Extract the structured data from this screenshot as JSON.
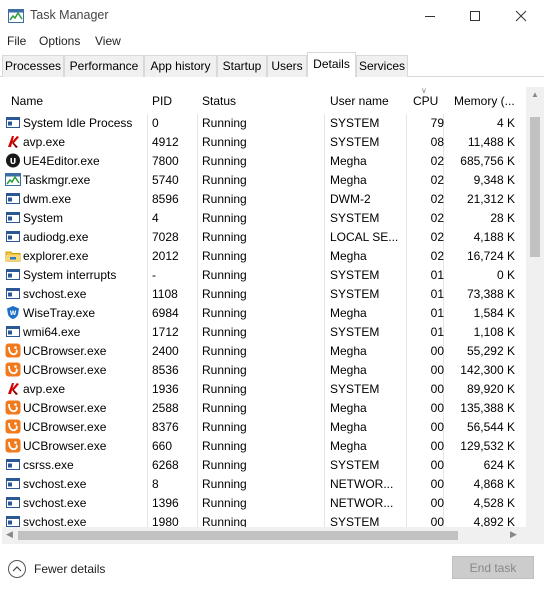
{
  "window": {
    "title": "Task Manager"
  },
  "menu": [
    "File",
    "Options",
    "View"
  ],
  "tabs": [
    {
      "label": "Processes",
      "active": false
    },
    {
      "label": "Performance",
      "active": false
    },
    {
      "label": "App history",
      "active": false
    },
    {
      "label": "Startup",
      "active": false
    },
    {
      "label": "Users",
      "active": false
    },
    {
      "label": "Details",
      "active": true
    },
    {
      "label": "Services",
      "active": false
    }
  ],
  "columns": {
    "name": "Name",
    "pid": "PID",
    "status": "Status",
    "user": "User name",
    "cpu": "CPU",
    "memory": "Memory (..."
  },
  "sort": {
    "column": "cpu",
    "direction": "descending"
  },
  "rows": [
    {
      "icon": "window-icon",
      "name": "System Idle Process",
      "pid": "0",
      "status": "Running",
      "user": "SYSTEM",
      "cpu": "79",
      "memory": "4 K"
    },
    {
      "icon": "kaspersky-icon",
      "name": "avp.exe",
      "pid": "4912",
      "status": "Running",
      "user": "SYSTEM",
      "cpu": "08",
      "memory": "11,488 K"
    },
    {
      "icon": "unreal-icon",
      "name": "UE4Editor.exe",
      "pid": "7800",
      "status": "Running",
      "user": "Megha",
      "cpu": "02",
      "memory": "685,756 K"
    },
    {
      "icon": "taskmgr-icon",
      "name": "Taskmgr.exe",
      "pid": "5740",
      "status": "Running",
      "user": "Megha",
      "cpu": "02",
      "memory": "9,348 K"
    },
    {
      "icon": "window-icon",
      "name": "dwm.exe",
      "pid": "8596",
      "status": "Running",
      "user": "DWM-2",
      "cpu": "02",
      "memory": "21,312 K"
    },
    {
      "icon": "window-icon",
      "name": "System",
      "pid": "4",
      "status": "Running",
      "user": "SYSTEM",
      "cpu": "02",
      "memory": "28 K"
    },
    {
      "icon": "window-icon",
      "name": "audiodg.exe",
      "pid": "7028",
      "status": "Running",
      "user": "LOCAL SE...",
      "cpu": "02",
      "memory": "4,188 K"
    },
    {
      "icon": "explorer-icon",
      "name": "explorer.exe",
      "pid": "2012",
      "status": "Running",
      "user": "Megha",
      "cpu": "02",
      "memory": "16,724 K"
    },
    {
      "icon": "window-icon",
      "name": "System interrupts",
      "pid": "-",
      "status": "Running",
      "user": "SYSTEM",
      "cpu": "01",
      "memory": "0 K"
    },
    {
      "icon": "window-icon",
      "name": "svchost.exe",
      "pid": "1108",
      "status": "Running",
      "user": "SYSTEM",
      "cpu": "01",
      "memory": "73,388 K"
    },
    {
      "icon": "wisetray-icon",
      "name": "WiseTray.exe",
      "pid": "6984",
      "status": "Running",
      "user": "Megha",
      "cpu": "01",
      "memory": "1,584 K"
    },
    {
      "icon": "window-icon",
      "name": "wmi64.exe",
      "pid": "1712",
      "status": "Running",
      "user": "SYSTEM",
      "cpu": "01",
      "memory": "1,108 K"
    },
    {
      "icon": "ucbrowser-icon",
      "name": "UCBrowser.exe",
      "pid": "2400",
      "status": "Running",
      "user": "Megha",
      "cpu": "00",
      "memory": "55,292 K"
    },
    {
      "icon": "ucbrowser-icon",
      "name": "UCBrowser.exe",
      "pid": "8536",
      "status": "Running",
      "user": "Megha",
      "cpu": "00",
      "memory": "142,300 K"
    },
    {
      "icon": "kaspersky-icon",
      "name": "avp.exe",
      "pid": "1936",
      "status": "Running",
      "user": "SYSTEM",
      "cpu": "00",
      "memory": "89,920 K"
    },
    {
      "icon": "ucbrowser-icon",
      "name": "UCBrowser.exe",
      "pid": "2588",
      "status": "Running",
      "user": "Megha",
      "cpu": "00",
      "memory": "135,388 K"
    },
    {
      "icon": "ucbrowser-icon",
      "name": "UCBrowser.exe",
      "pid": "8376",
      "status": "Running",
      "user": "Megha",
      "cpu": "00",
      "memory": "56,544 K"
    },
    {
      "icon": "ucbrowser-icon",
      "name": "UCBrowser.exe",
      "pid": "660",
      "status": "Running",
      "user": "Megha",
      "cpu": "00",
      "memory": "129,532 K"
    },
    {
      "icon": "window-icon",
      "name": "csrss.exe",
      "pid": "6268",
      "status": "Running",
      "user": "SYSTEM",
      "cpu": "00",
      "memory": "624 K"
    },
    {
      "icon": "window-icon",
      "name": "svchost.exe",
      "pid": "8",
      "status": "Running",
      "user": "NETWOR...",
      "cpu": "00",
      "memory": "4,868 K"
    },
    {
      "icon": "window-icon",
      "name": "svchost.exe",
      "pid": "1396",
      "status": "Running",
      "user": "NETWOR...",
      "cpu": "00",
      "memory": "4,528 K"
    },
    {
      "icon": "window-icon",
      "name": "svchost.exe",
      "pid": "1980",
      "status": "Running",
      "user": "SYSTEM",
      "cpu": "00",
      "memory": "4,892 K"
    }
  ],
  "footer": {
    "fewer_details": "Fewer details",
    "end_task": "End task"
  },
  "colors": {
    "tab_border": "#d9d9d9",
    "disabled_button": "#cccccc"
  }
}
